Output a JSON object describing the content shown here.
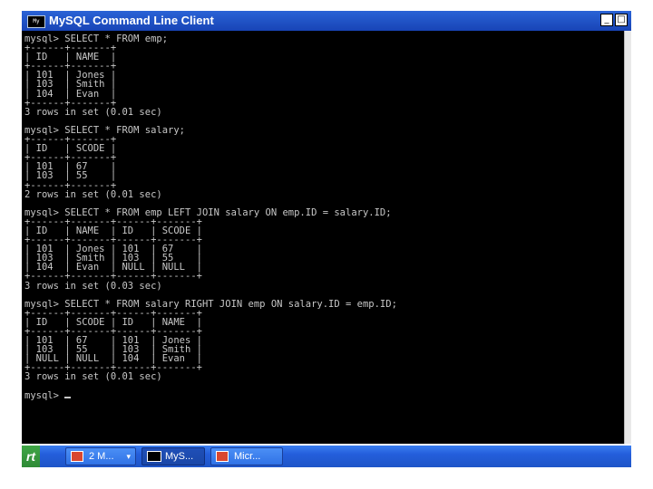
{
  "window": {
    "title": "MySQL Command Line Client",
    "icon_label": "My"
  },
  "window_controls": {
    "minimize": "_",
    "maximize": "□"
  },
  "console": {
    "lines": [
      "mysql> SELECT * FROM emp;",
      "+------+-------+",
      "| ID   | NAME  |",
      "+------+-------+",
      "| 101  | Jones |",
      "| 103  | Smith |",
      "| 104  | Evan  |",
      "+------+-------+",
      "3 rows in set (0.01 sec)",
      "",
      "mysql> SELECT * FROM salary;",
      "+------+-------+",
      "| ID   | SCODE |",
      "+------+-------+",
      "| 101  | 67    |",
      "| 103  | 55    |",
      "+------+-------+",
      "2 rows in set (0.01 sec)",
      "",
      "mysql> SELECT * FROM emp LEFT JOIN salary ON emp.ID = salary.ID;",
      "+------+-------+------+-------+",
      "| ID   | NAME  | ID   | SCODE |",
      "+------+-------+------+-------+",
      "| 101  | Jones | 101  | 67    |",
      "| 103  | Smith | 103  | 55    |",
      "| 104  | Evan  | NULL | NULL  |",
      "+------+-------+------+-------+",
      "3 rows in set (0.03 sec)",
      "",
      "mysql> SELECT * FROM salary RIGHT JOIN emp ON salary.ID = emp.ID;",
      "+------+-------+------+-------+",
      "| ID   | SCODE | ID   | NAME  |",
      "+------+-------+------+-------+",
      "| 101  | 67    | 101  | Jones |",
      "| 103  | 55    | 103  | Smith |",
      "| NULL | NULL  | 104  | Evan  |",
      "+------+-------+------+-------+",
      "3 rows in set (0.01 sec)",
      "",
      "mysql> "
    ]
  },
  "taskbar": {
    "start_label": "rt",
    "tasks": [
      {
        "label": "2 M...",
        "icon": "presentation-icon",
        "caret": "▾"
      },
      {
        "label": "MyS...",
        "icon": "mysql-console-icon"
      },
      {
        "label": "Micr...",
        "icon": "powerpoint-icon"
      }
    ]
  },
  "colors": {
    "console_bg": "#000000",
    "console_text": "#c8c8c8",
    "titlebar": "#1f55c8",
    "taskbar": "#245edb"
  }
}
